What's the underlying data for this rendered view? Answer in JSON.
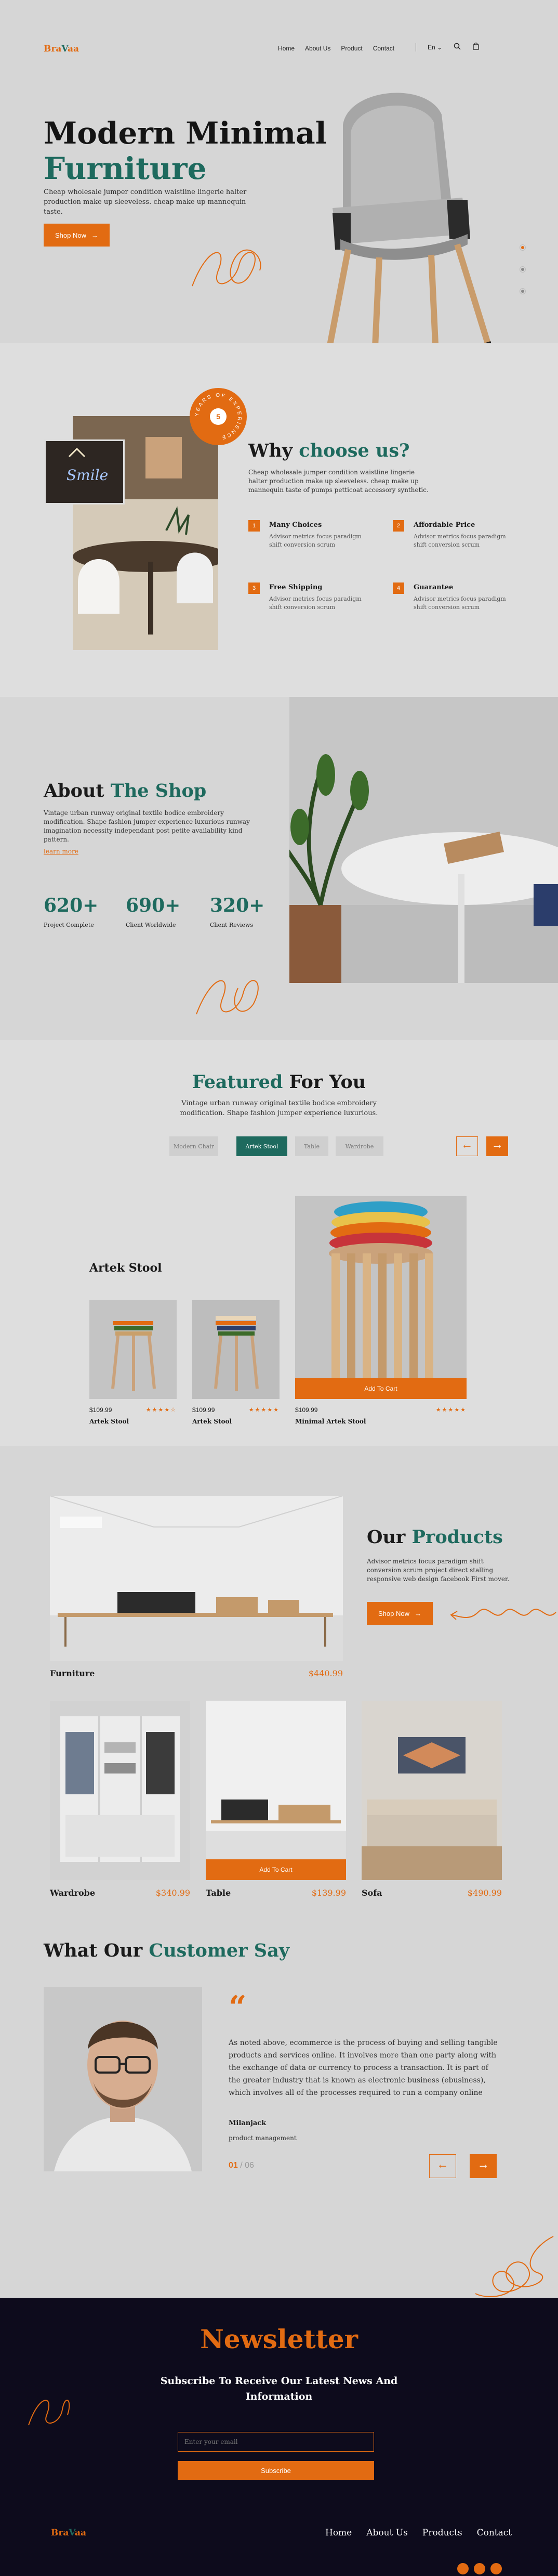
{
  "header": {
    "logo_a": "Bra",
    "logo_b": "V",
    "logo_c": "aa",
    "nav": [
      "Home",
      "About Us",
      "Product",
      "Contact"
    ],
    "lang": "En"
  },
  "hero": {
    "title_line1": "Modern Minimal",
    "title_line2": "Furniture",
    "description": "Cheap wholesale jumper condition waistline lingerie halter production make up sleeveless. cheap make up mannequin taste.",
    "cta": "Shop Now"
  },
  "why": {
    "badge_years": "5",
    "badge_text": "YEARS OF EXPERIENCE",
    "title_a": "Why ",
    "title_b": "choose us?",
    "description": "Cheap wholesale jumper condition waistline lingerie halter production make up sleeveless. cheap make up mannequin taste of pumps petticoat accessory synthetic.",
    "features": [
      {
        "num": "1",
        "title": "Many Choices",
        "text": "Advisor metrics focus paradigm shift conversion scrum"
      },
      {
        "num": "2",
        "title": "Affordable Price",
        "text": "Advisor metrics focus paradigm shift conversion scrum"
      },
      {
        "num": "3",
        "title": "Free Shipping",
        "text": "Advisor metrics focus paradigm shift conversion scrum"
      },
      {
        "num": "4",
        "title": "Guarantee",
        "text": "Advisor metrics focus paradigm shift conversion scrum"
      }
    ],
    "sign_text": "Smile"
  },
  "about": {
    "title_a": "About ",
    "title_b": "The Shop",
    "description": "Vintage urban runway original textile bodice embroidery modification. Shape fashion jumper experience luxurious runway imagination necessity independant post petite availability kind pattern.",
    "learn_more": "learn more",
    "stats": [
      {
        "value": "620+",
        "label": "Project Complete"
      },
      {
        "value": "690+",
        "label": "Client Worldwide"
      },
      {
        "value": "320+",
        "label": "Client Reviews"
      }
    ]
  },
  "featured": {
    "title_a": "Featured",
    "title_b": " For You",
    "description": "Vintage urban runway original textile bodice embroidery modification. Shape fashion jumper experience luxurious.",
    "tabs": [
      "Modern Chair",
      "Artek Stool",
      "Table",
      "Wardrobe"
    ],
    "section_title": "Artek Stool",
    "products": [
      {
        "price": "$109.99",
        "stars": "★★★★☆",
        "name": "Artek Stool"
      },
      {
        "price": "$109.99",
        "stars": "★★★★★",
        "name": "Artek Stool"
      },
      {
        "price": "$109.99",
        "stars": "★★★★★",
        "name": "Minimal Artek Stool"
      }
    ],
    "add_to_cart": "Add To Cart"
  },
  "products": {
    "title_a": "Our ",
    "title_b": "Products",
    "description": "Advisor metrics focus paradigm shift conversion scrum project direct stalling responsive web design facebook First mover.",
    "cta": "Shop Now",
    "main": {
      "name": "Furniture",
      "price": "$440.99"
    },
    "items": [
      {
        "name": "Wardrobe",
        "price": "$340.99"
      },
      {
        "name": "Table",
        "price": "$139.99"
      },
      {
        "name": "Sofa",
        "price": "$490.99"
      }
    ],
    "add_to_cart": "Add To Cart"
  },
  "testimonial": {
    "title_a": "What Our ",
    "title_b": "Customer Say",
    "quote_mark": "“",
    "body": "As noted above, ecommerce is the process of buying and selling tangible products and services online. It involves more than one party along with the exchange of data or currency to process a transaction. It is part of the greater industry that is known as electronic business (ebusiness), which involves all of the processes required to run a company online",
    "author": "Milanjack",
    "role": "product management",
    "page_current": "01",
    "page_sep": " / ",
    "page_total": "06"
  },
  "newsletter": {
    "title": "Newsletter",
    "subtitle_line1": "Subscribe To Receive Our Latest News And",
    "subtitle_line2": "Information",
    "placeholder": "Enter your email",
    "button": "Subscribe"
  },
  "footer": {
    "logo_a": "Bra",
    "logo_b": "V",
    "logo_c": "aa",
    "nav": [
      "Home",
      "About Us",
      "Products",
      "Contact"
    ]
  },
  "colors": {
    "accent": "#e26b12",
    "brand": "#1e6a5e",
    "dark": "#0d0b1c",
    "bg": "#d6d6d6"
  }
}
